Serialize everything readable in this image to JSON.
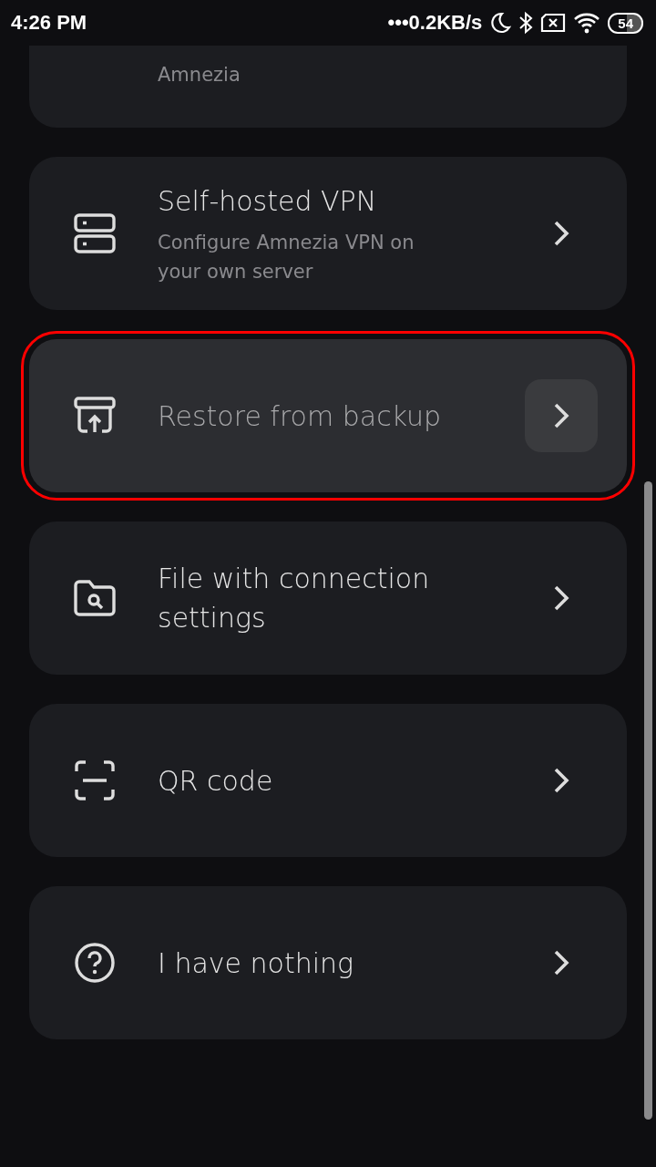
{
  "status_bar": {
    "time": "4:26 PM",
    "speed": "•••0.2KB/s",
    "battery": "54"
  },
  "top_card": {
    "description": [
      "Amnezia"
    ]
  },
  "items": [
    {
      "kind": "server",
      "title": "Self-hosted VPN",
      "description": "Configure Amnezia VPN on your own server",
      "selected": false
    },
    {
      "kind": "backup",
      "title": "Restore from backup",
      "selected": true
    },
    {
      "kind": "file",
      "title": "File with connection settings",
      "selected": false
    },
    {
      "kind": "qr",
      "title": "QR code",
      "selected": false
    },
    {
      "kind": "help",
      "title": "I have nothing",
      "selected": false
    }
  ]
}
